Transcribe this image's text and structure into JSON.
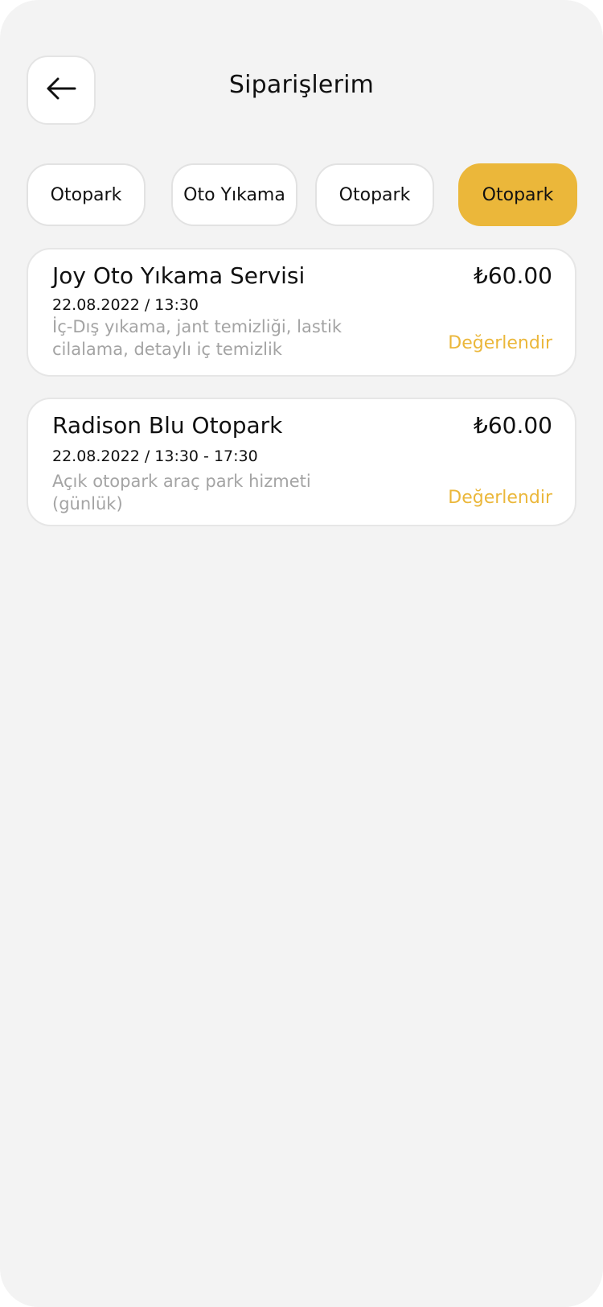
{
  "header": {
    "title": "Siparişlerim",
    "back_icon": "arrow-left-icon"
  },
  "filters": {
    "chips": [
      {
        "label": "Otopark",
        "active": false
      },
      {
        "label": "Oto Yıkama",
        "active": false
      },
      {
        "label": "Otopark",
        "active": false
      },
      {
        "label": "Otopark",
        "active": true
      }
    ]
  },
  "orders": [
    {
      "title": "Joy Oto Yıkama Servisi",
      "datetime": "22.08.2022 / 13:30",
      "description": "İç-Dış yıkama, jant temizliği, lastik cilalama, detaylı iç temizlik",
      "price": "₺60.00",
      "action": "Değerlendir"
    },
    {
      "title": "Radison Blu Otopark",
      "datetime": "22.08.2022 / 13:30 - 17:30",
      "description": "Açık otopark araç park hizmeti (günlük)",
      "price": "₺60.00",
      "action": "Değerlendir"
    }
  ],
  "colors": {
    "background": "#f3f3f3",
    "accent": "#ebb73a",
    "card": "#ffffff",
    "text": "#111111",
    "muted": "#a4a4a4"
  }
}
